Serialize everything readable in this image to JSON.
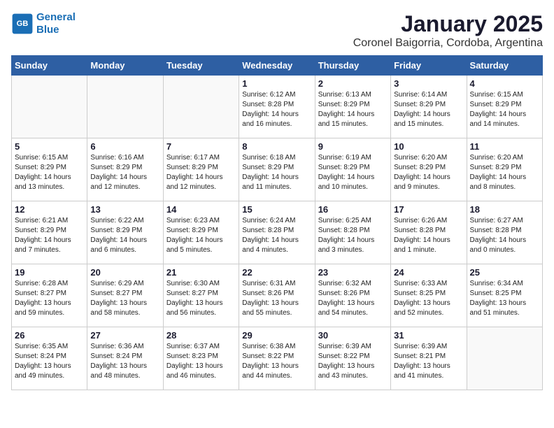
{
  "header": {
    "logo_line1": "General",
    "logo_line2": "Blue",
    "title": "January 2025",
    "subtitle": "Coronel Baigorria, Cordoba, Argentina"
  },
  "days_of_week": [
    "Sunday",
    "Monday",
    "Tuesday",
    "Wednesday",
    "Thursday",
    "Friday",
    "Saturday"
  ],
  "weeks": [
    [
      {
        "day": "",
        "info": ""
      },
      {
        "day": "",
        "info": ""
      },
      {
        "day": "",
        "info": ""
      },
      {
        "day": "1",
        "info": "Sunrise: 6:12 AM\nSunset: 8:28 PM\nDaylight: 14 hours\nand 16 minutes."
      },
      {
        "day": "2",
        "info": "Sunrise: 6:13 AM\nSunset: 8:29 PM\nDaylight: 14 hours\nand 15 minutes."
      },
      {
        "day": "3",
        "info": "Sunrise: 6:14 AM\nSunset: 8:29 PM\nDaylight: 14 hours\nand 15 minutes."
      },
      {
        "day": "4",
        "info": "Sunrise: 6:15 AM\nSunset: 8:29 PM\nDaylight: 14 hours\nand 14 minutes."
      }
    ],
    [
      {
        "day": "5",
        "info": "Sunrise: 6:15 AM\nSunset: 8:29 PM\nDaylight: 14 hours\nand 13 minutes."
      },
      {
        "day": "6",
        "info": "Sunrise: 6:16 AM\nSunset: 8:29 PM\nDaylight: 14 hours\nand 12 minutes."
      },
      {
        "day": "7",
        "info": "Sunrise: 6:17 AM\nSunset: 8:29 PM\nDaylight: 14 hours\nand 12 minutes."
      },
      {
        "day": "8",
        "info": "Sunrise: 6:18 AM\nSunset: 8:29 PM\nDaylight: 14 hours\nand 11 minutes."
      },
      {
        "day": "9",
        "info": "Sunrise: 6:19 AM\nSunset: 8:29 PM\nDaylight: 14 hours\nand 10 minutes."
      },
      {
        "day": "10",
        "info": "Sunrise: 6:20 AM\nSunset: 8:29 PM\nDaylight: 14 hours\nand 9 minutes."
      },
      {
        "day": "11",
        "info": "Sunrise: 6:20 AM\nSunset: 8:29 PM\nDaylight: 14 hours\nand 8 minutes."
      }
    ],
    [
      {
        "day": "12",
        "info": "Sunrise: 6:21 AM\nSunset: 8:29 PM\nDaylight: 14 hours\nand 7 minutes."
      },
      {
        "day": "13",
        "info": "Sunrise: 6:22 AM\nSunset: 8:29 PM\nDaylight: 14 hours\nand 6 minutes."
      },
      {
        "day": "14",
        "info": "Sunrise: 6:23 AM\nSunset: 8:29 PM\nDaylight: 14 hours\nand 5 minutes."
      },
      {
        "day": "15",
        "info": "Sunrise: 6:24 AM\nSunset: 8:28 PM\nDaylight: 14 hours\nand 4 minutes."
      },
      {
        "day": "16",
        "info": "Sunrise: 6:25 AM\nSunset: 8:28 PM\nDaylight: 14 hours\nand 3 minutes."
      },
      {
        "day": "17",
        "info": "Sunrise: 6:26 AM\nSunset: 8:28 PM\nDaylight: 14 hours\nand 1 minute."
      },
      {
        "day": "18",
        "info": "Sunrise: 6:27 AM\nSunset: 8:28 PM\nDaylight: 14 hours\nand 0 minutes."
      }
    ],
    [
      {
        "day": "19",
        "info": "Sunrise: 6:28 AM\nSunset: 8:27 PM\nDaylight: 13 hours\nand 59 minutes."
      },
      {
        "day": "20",
        "info": "Sunrise: 6:29 AM\nSunset: 8:27 PM\nDaylight: 13 hours\nand 58 minutes."
      },
      {
        "day": "21",
        "info": "Sunrise: 6:30 AM\nSunset: 8:27 PM\nDaylight: 13 hours\nand 56 minutes."
      },
      {
        "day": "22",
        "info": "Sunrise: 6:31 AM\nSunset: 8:26 PM\nDaylight: 13 hours\nand 55 minutes."
      },
      {
        "day": "23",
        "info": "Sunrise: 6:32 AM\nSunset: 8:26 PM\nDaylight: 13 hours\nand 54 minutes."
      },
      {
        "day": "24",
        "info": "Sunrise: 6:33 AM\nSunset: 8:25 PM\nDaylight: 13 hours\nand 52 minutes."
      },
      {
        "day": "25",
        "info": "Sunrise: 6:34 AM\nSunset: 8:25 PM\nDaylight: 13 hours\nand 51 minutes."
      }
    ],
    [
      {
        "day": "26",
        "info": "Sunrise: 6:35 AM\nSunset: 8:24 PM\nDaylight: 13 hours\nand 49 minutes."
      },
      {
        "day": "27",
        "info": "Sunrise: 6:36 AM\nSunset: 8:24 PM\nDaylight: 13 hours\nand 48 minutes."
      },
      {
        "day": "28",
        "info": "Sunrise: 6:37 AM\nSunset: 8:23 PM\nDaylight: 13 hours\nand 46 minutes."
      },
      {
        "day": "29",
        "info": "Sunrise: 6:38 AM\nSunset: 8:22 PM\nDaylight: 13 hours\nand 44 minutes."
      },
      {
        "day": "30",
        "info": "Sunrise: 6:39 AM\nSunset: 8:22 PM\nDaylight: 13 hours\nand 43 minutes."
      },
      {
        "day": "31",
        "info": "Sunrise: 6:39 AM\nSunset: 8:21 PM\nDaylight: 13 hours\nand 41 minutes."
      },
      {
        "day": "",
        "info": ""
      }
    ]
  ]
}
